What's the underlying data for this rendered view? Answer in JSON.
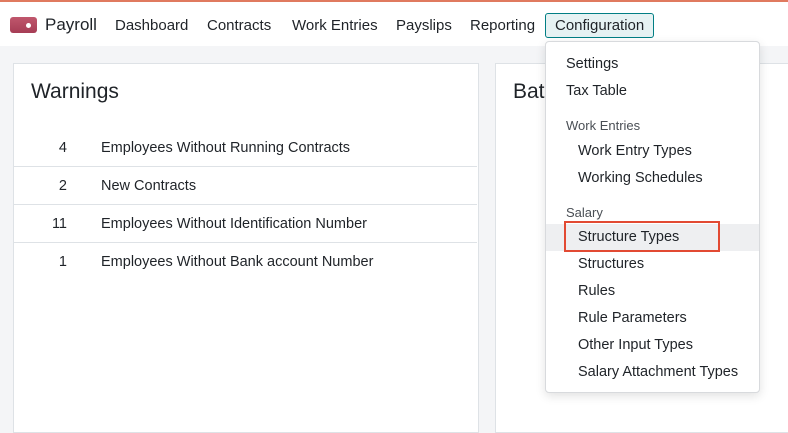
{
  "app": {
    "name": "Payroll",
    "accent_color": "#017e84",
    "brand_icon": "payroll-app-icon"
  },
  "nav": {
    "items": [
      {
        "label": "Dashboard"
      },
      {
        "label": "Contracts"
      },
      {
        "label": "Work Entries"
      },
      {
        "label": "Payslips"
      },
      {
        "label": "Reporting"
      },
      {
        "label": "Configuration",
        "active": true
      }
    ]
  },
  "warnings": {
    "title": "Warnings",
    "rows": [
      {
        "count": "4",
        "label": "Employees Without Running Contracts"
      },
      {
        "count": "2",
        "label": "New Contracts"
      },
      {
        "count": "11",
        "label": "Employees Without Identification Number"
      },
      {
        "count": "1",
        "label": "Employees Without Bank account Number"
      }
    ]
  },
  "batches": {
    "title_partial": "Batc"
  },
  "config_menu": {
    "items_top": [
      "Settings",
      "Tax Table"
    ],
    "work_entries_header": "Work Entries",
    "work_entries_items": [
      "Work Entry Types",
      "Working Schedules"
    ],
    "salary_header": "Salary",
    "salary_items": [
      "Structure Types",
      "Structures",
      "Rules",
      "Rule Parameters",
      "Other Input Types",
      "Salary Attachment Types"
    ],
    "highlighted_item": "Structure Types",
    "highlight_color": "#e24a33"
  }
}
